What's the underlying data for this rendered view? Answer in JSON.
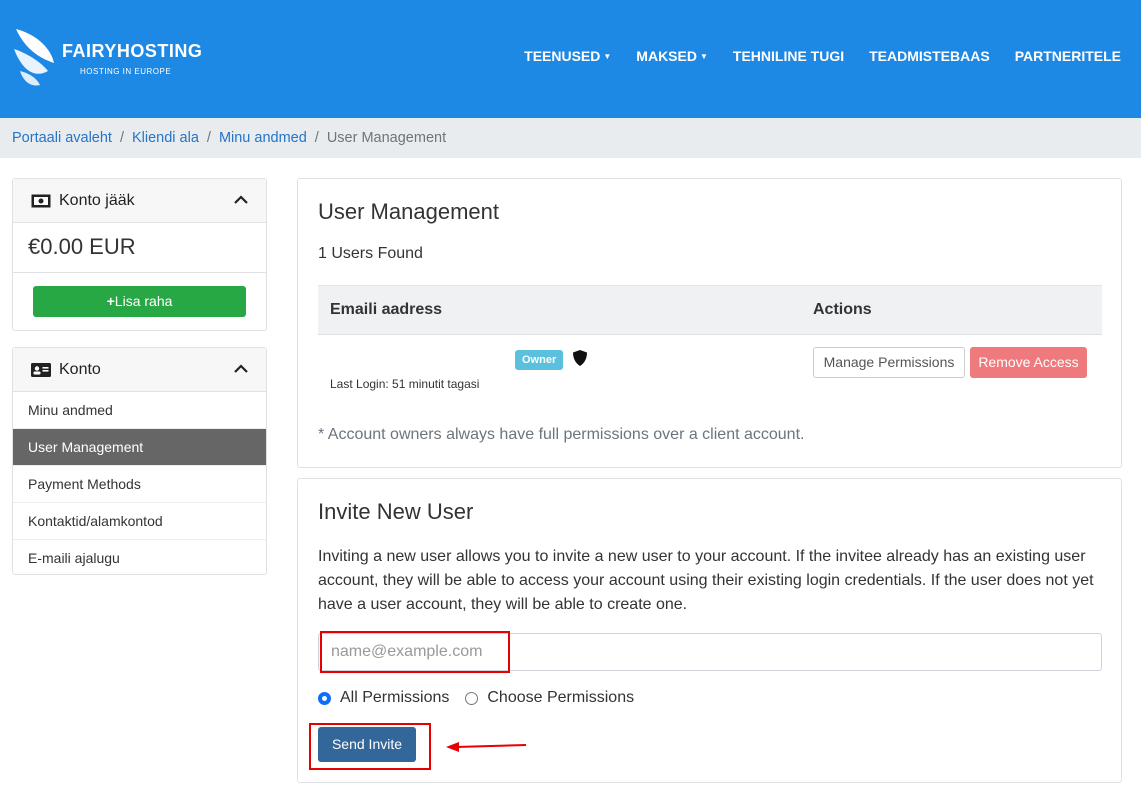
{
  "brand": {
    "name": "FAIRYHOSTING",
    "tagline": "HOSTING IN EUROPE",
    "logo_icon": "butterfly-wing-icon"
  },
  "nav": [
    {
      "label": "TEENUSED",
      "dropdown": true
    },
    {
      "label": "MAKSED",
      "dropdown": true
    },
    {
      "label": "TEHNILINE TUGI",
      "dropdown": false
    },
    {
      "label": "TEADMISTEBAAS",
      "dropdown": false
    },
    {
      "label": "PARTNERITELE",
      "dropdown": false
    }
  ],
  "breadcrumb": {
    "items": [
      "Portaali avaleht",
      "Kliendi ala",
      "Minu andmed"
    ],
    "current": "User Management"
  },
  "sidebar": {
    "balance_panel": {
      "title": "Konto jääk",
      "icon": "money-bill-icon",
      "amount": "€0.00 EUR",
      "add_funds_label": "Lisa raha"
    },
    "account_panel": {
      "title": "Konto",
      "icon": "id-card-icon",
      "items": [
        {
          "label": "Minu andmed",
          "active": false
        },
        {
          "label": "User Management",
          "active": true
        },
        {
          "label": "Payment Methods",
          "active": false
        },
        {
          "label": "Kontaktid/alamkontod",
          "active": false
        },
        {
          "label": "E-maili ajalugu",
          "active": false
        }
      ]
    }
  },
  "user_management": {
    "title": "User Management",
    "count_text": "1 Users Found",
    "columns": {
      "email": "Emaili aadress",
      "actions": "Actions"
    },
    "rows": [
      {
        "badge": "Owner",
        "last_login": "Last Login: 51 minutit tagasi",
        "manage_label": "Manage Permissions",
        "remove_label": "Remove Access"
      }
    ],
    "note": "* Account owners always have full permissions over a client account."
  },
  "invite": {
    "title": "Invite New User",
    "description": "Inviting a new user allows you to invite a new user to your account. If the invitee already has an existing user account, they will be able to access your account using their existing login credentials. If the user does not yet have a user account, they will be able to create one.",
    "email_placeholder": "name@example.com",
    "email_value": "",
    "permissions": [
      {
        "label": "All Permissions",
        "checked": true
      },
      {
        "label": "Choose Permissions",
        "checked": false
      }
    ],
    "send_label": "Send Invite"
  },
  "colors": {
    "header": "#1e88e5",
    "success": "#28a745",
    "danger": "#ee7a7d",
    "primary": "#336699",
    "annotation": "#e60000"
  }
}
